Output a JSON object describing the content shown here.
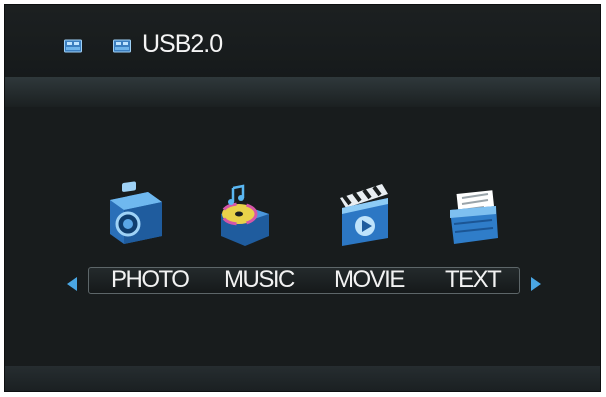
{
  "header": {
    "title": "USB2.0",
    "drive_icons": [
      "usb-drive-icon",
      "usb-drive-icon"
    ]
  },
  "menu": {
    "items": [
      {
        "label": "PHOTO",
        "icon": "camera-icon"
      },
      {
        "label": "MUSIC",
        "icon": "music-disc-icon"
      },
      {
        "label": "MOVIE",
        "icon": "clapperboard-icon"
      },
      {
        "label": "TEXT",
        "icon": "document-folder-icon"
      }
    ],
    "nav": {
      "left": "arrow-left-icon",
      "right": "arrow-right-icon"
    }
  },
  "colors": {
    "background": "#181c1d",
    "accent": "#4aa6e3",
    "text": "#f2f2f2"
  }
}
